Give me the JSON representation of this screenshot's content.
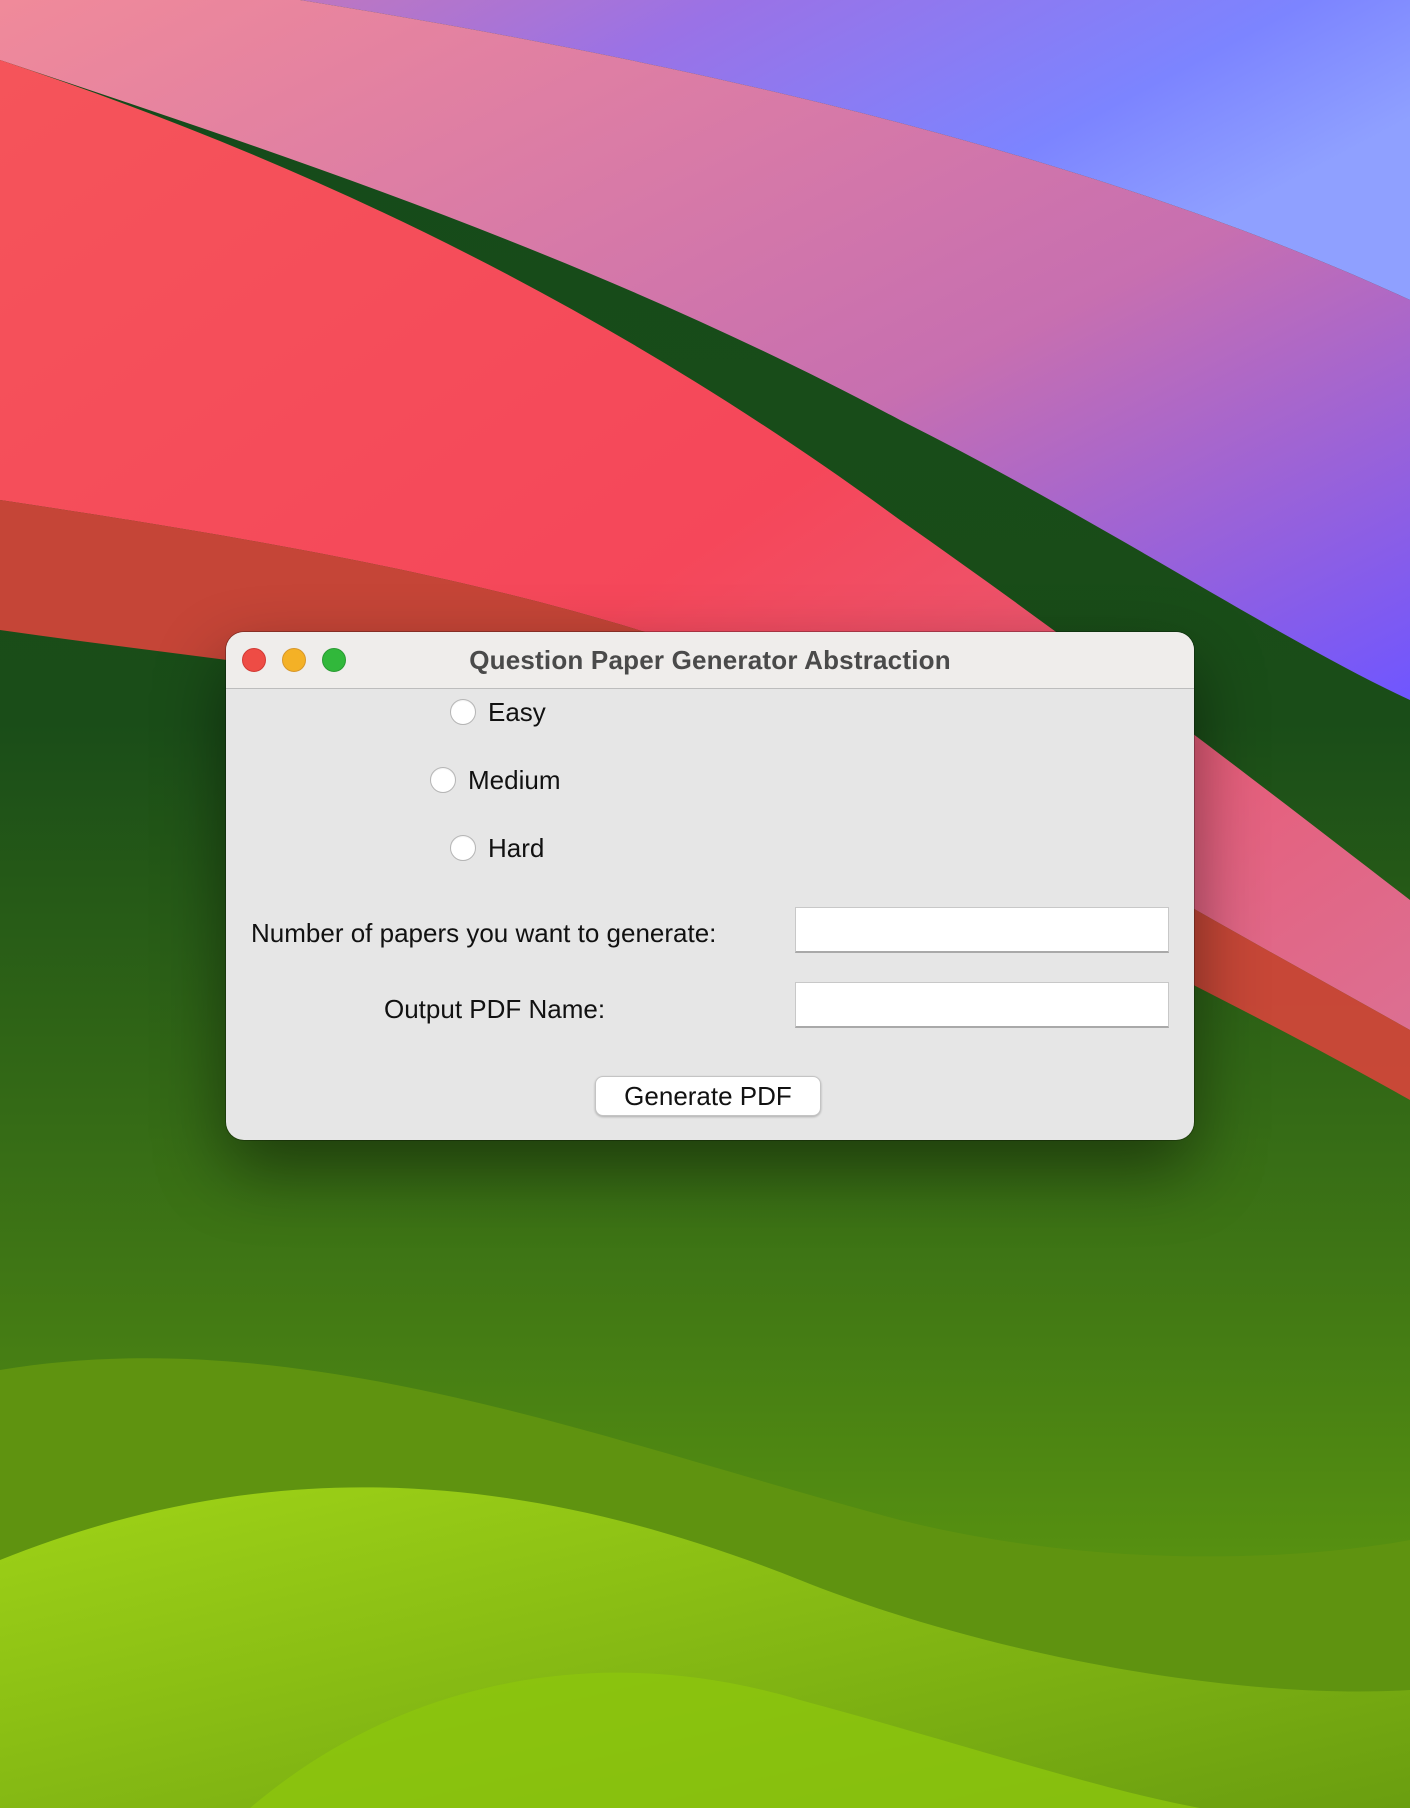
{
  "window": {
    "title": "Question Paper Generator Abstraction"
  },
  "difficulty": {
    "options": [
      {
        "label": "Easy",
        "selected": false
      },
      {
        "label": "Medium",
        "selected": false
      },
      {
        "label": "Hard",
        "selected": false
      }
    ]
  },
  "form": {
    "num_papers_label": "Number of papers you want to generate:",
    "num_papers_value": "",
    "output_name_label": "Output PDF Name:",
    "output_name_value": "",
    "generate_label": "Generate PDF"
  },
  "colors": {
    "close": "#ee4c45",
    "minimize": "#f4b126",
    "maximize": "#31b83b",
    "window_bg": "#e6e6e6",
    "titlebar_bg": "#efedeb"
  }
}
